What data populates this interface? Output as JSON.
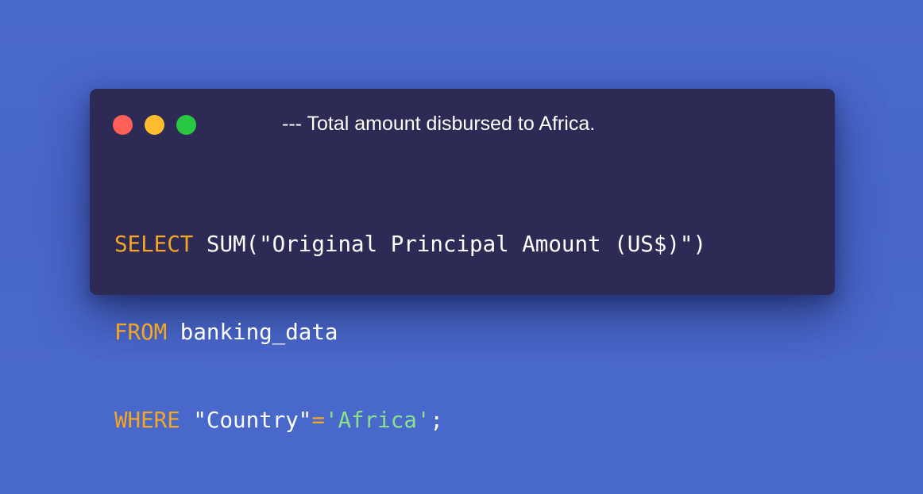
{
  "window": {
    "title": "--- Total amount disbursed to Africa."
  },
  "traffic_lights": {
    "close_color": "#ff5f57",
    "minimize_color": "#febc2e",
    "maximize_color": "#28c840"
  },
  "code": {
    "lines": [
      {
        "tokens": [
          {
            "type": "keyword",
            "text": "SELECT"
          },
          {
            "type": "plain",
            "text": " SUM(\"Original Principal Amount (US$)\")"
          }
        ]
      },
      {
        "tokens": [
          {
            "type": "keyword",
            "text": "FROM"
          },
          {
            "type": "plain",
            "text": " banking_data"
          }
        ]
      },
      {
        "tokens": [
          {
            "type": "keyword",
            "text": "WHERE"
          },
          {
            "type": "plain",
            "text": " \"Country\""
          },
          {
            "type": "operator",
            "text": "="
          },
          {
            "type": "string",
            "text": "'Africa'"
          },
          {
            "type": "plain",
            "text": ";"
          }
        ]
      }
    ]
  },
  "colors": {
    "background": "#4868cc",
    "window": "#2d2a55",
    "keyword": "#f5a623",
    "string": "#8be28b",
    "text": "#ffffff"
  }
}
